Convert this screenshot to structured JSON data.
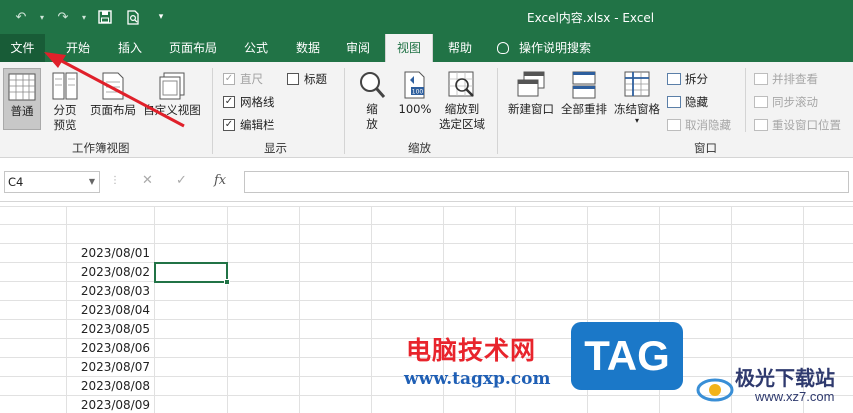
{
  "window": {
    "title": "Excel内容.xlsx  -  Excel"
  },
  "tabs": [
    {
      "label": "文件"
    },
    {
      "label": "开始"
    },
    {
      "label": "插入"
    },
    {
      "label": "页面布局"
    },
    {
      "label": "公式"
    },
    {
      "label": "数据"
    },
    {
      "label": "审阅"
    },
    {
      "label": "视图"
    },
    {
      "label": "帮助"
    },
    {
      "label": "操作说明搜索"
    }
  ],
  "ribbon": {
    "workbook_views": {
      "label": "工作簿视图",
      "normal": "普通",
      "page_break_line1": "分页",
      "page_break_line2": "预览",
      "page_layout": "页面布局",
      "custom_views": "自定义视图"
    },
    "show": {
      "label": "显示",
      "ruler": "直尺",
      "headings": "标题",
      "gridlines": "网格线",
      "formula_bar": "编辑栏"
    },
    "zoom": {
      "label": "缩放",
      "zoom_line1": "缩",
      "zoom_line2": "放",
      "hundred": "100%",
      "zoom_sel_line1": "缩放到",
      "zoom_sel_line2": "选定区域"
    },
    "window": {
      "label": "窗口",
      "new_window": "新建窗口",
      "arrange_all": "全部重排",
      "freeze_panes": "冻结窗格",
      "split": "拆分",
      "hide": "隐藏",
      "unhide": "取消隐藏",
      "side_by_side": "并排查看",
      "sync_scroll": "同步滚动",
      "reset_position": "重设窗口位置"
    }
  },
  "formula_bar": {
    "name_box": "C4",
    "fx": "fx",
    "value": ""
  },
  "cells": [
    "2023/08/01",
    "2023/08/02",
    "2023/08/03",
    "2023/08/04",
    "2023/08/05",
    "2023/08/06",
    "2023/08/07",
    "2023/08/08",
    "2023/08/09"
  ],
  "watermark": {
    "site_cn": "电脑技术网",
    "site_url": "www.tagxp.com",
    "tag": "TAG",
    "jg": "极光下载站",
    "jg_url": "www.xz7.com"
  },
  "colors": {
    "excel_green": "#217346",
    "arrow_red": "#e0202a"
  }
}
